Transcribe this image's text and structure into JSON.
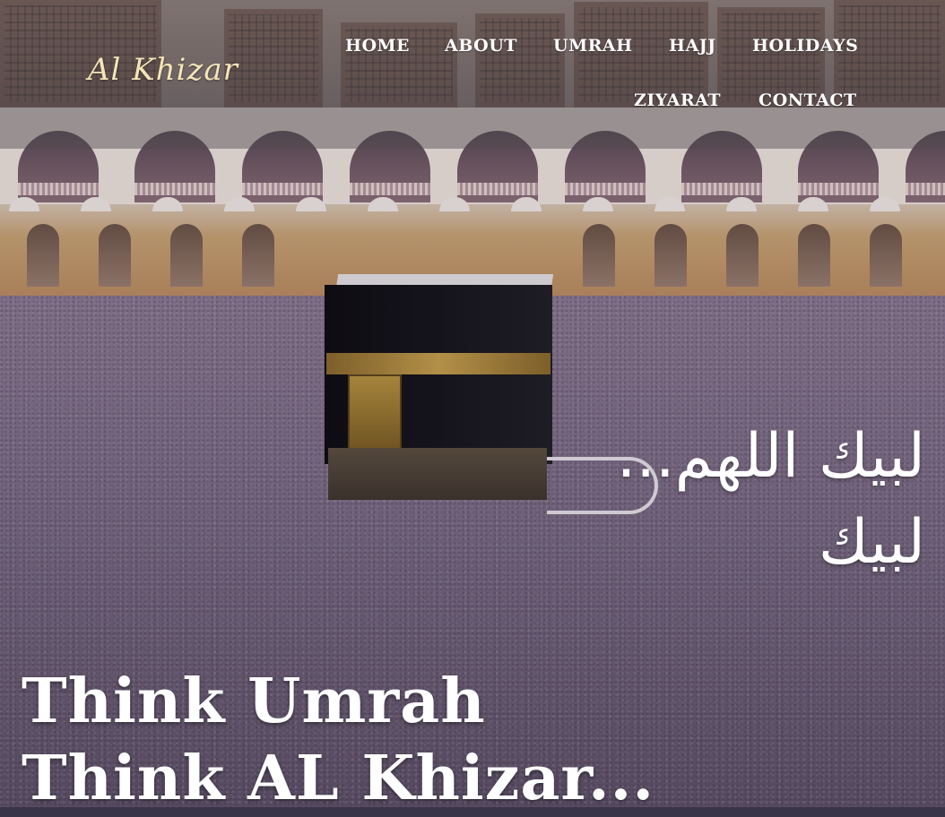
{
  "header": {
    "logo_text": "Al Khizar"
  },
  "nav": {
    "items": [
      {
        "label": "HOME"
      },
      {
        "label": "ABOUT"
      },
      {
        "label": "UMRAH"
      },
      {
        "label": "HAJJ"
      },
      {
        "label": "HOLIDAYS"
      },
      {
        "label": "ZIYARAT"
      },
      {
        "label": "CONTACT"
      }
    ]
  },
  "hero": {
    "arabic_text": "لبيك اللهم... لبيك",
    "tagline": "Think Umrah Think AL Khizar...",
    "image_subject": "kaaba-crowd-photo"
  },
  "colors": {
    "logo": "#f4e5b8",
    "nav_text": "#ffffff",
    "navbar_bg": "rgba(80,74,78,0.45)"
  }
}
